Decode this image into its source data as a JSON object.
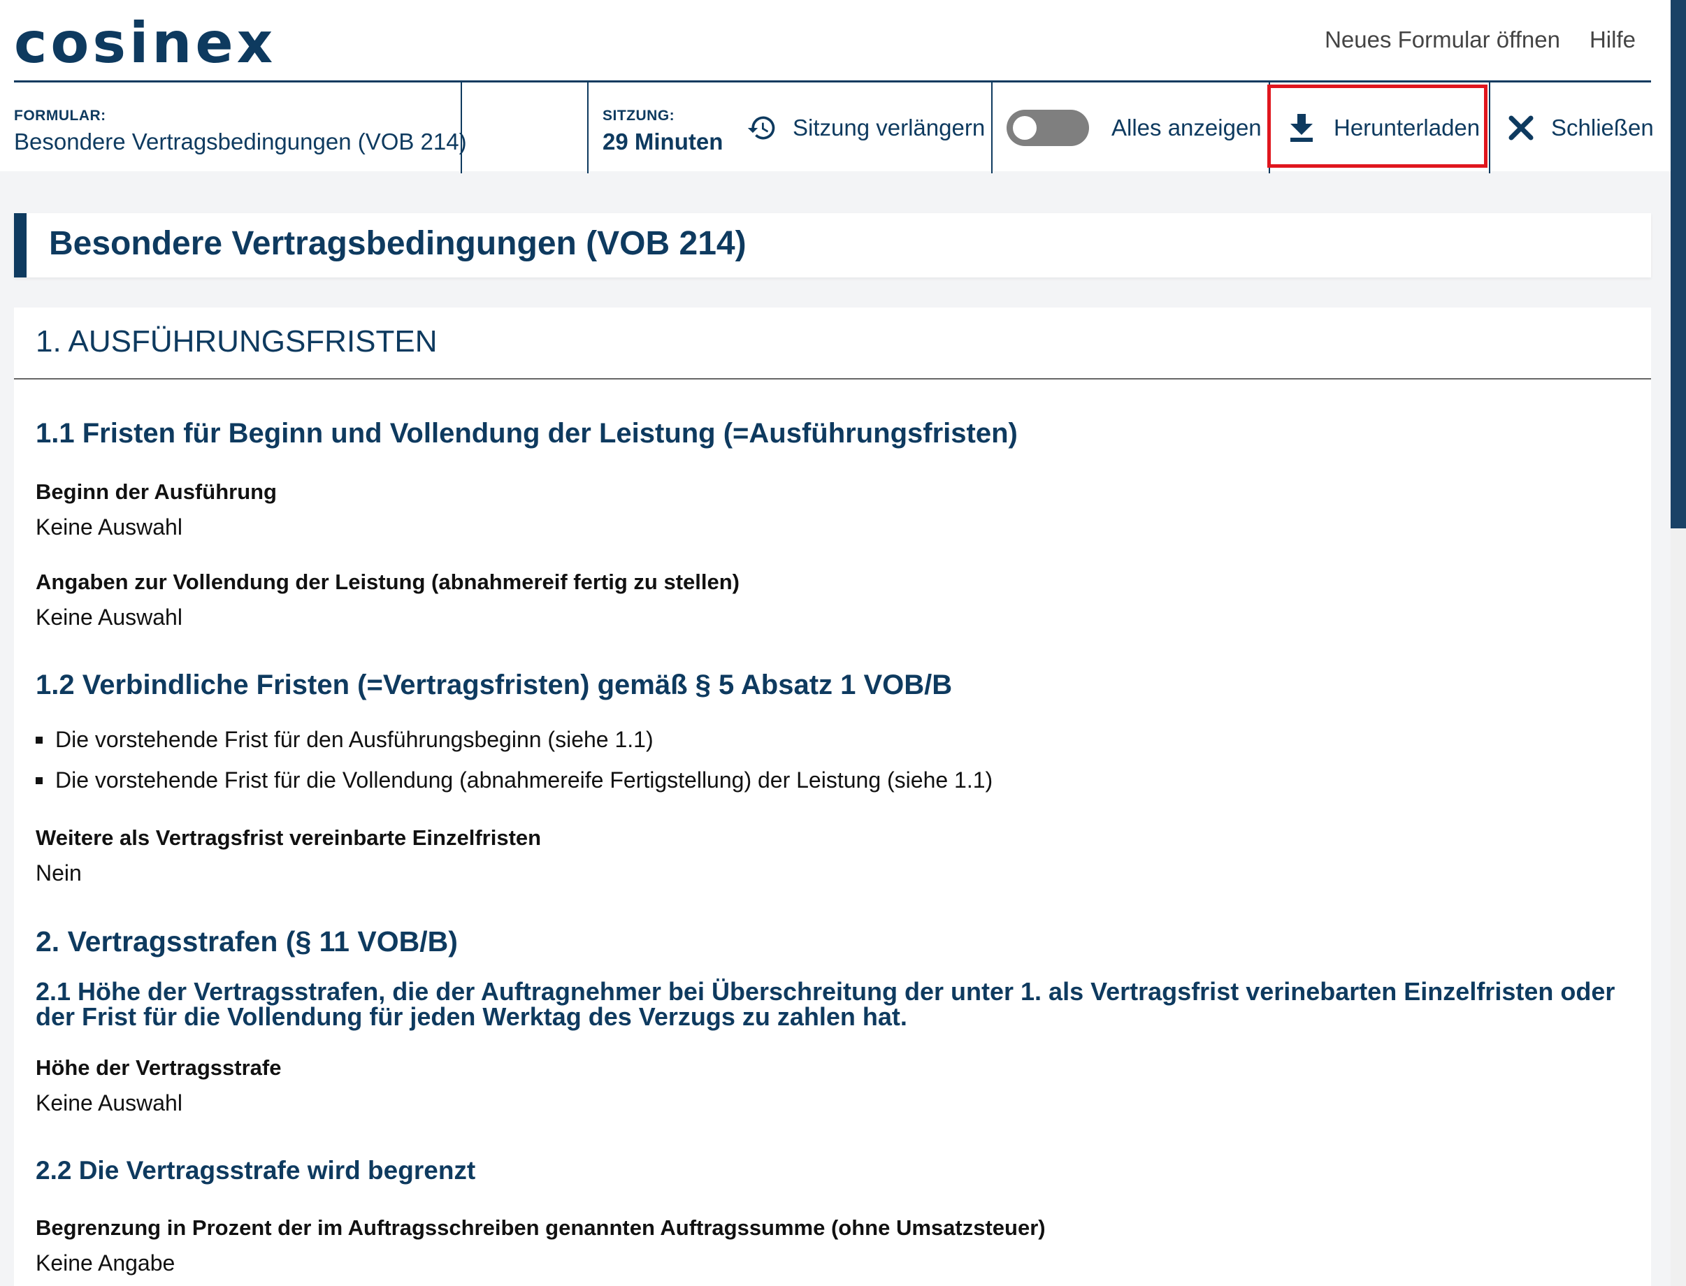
{
  "app": {
    "logo": "cosinex",
    "links": {
      "new_form": "Neues Formular öffnen",
      "help": "Hilfe"
    }
  },
  "toolbar": {
    "form_label": "FORMULAR:",
    "form_value": "Besondere Vertragsbedingungen (VOB 214)",
    "session_label": "SITZUNG:",
    "session_value": "29 Minuten",
    "extend_session": "Sitzung verlängern",
    "show_all": "Alles anzeigen",
    "show_all_enabled": false,
    "download": "Herunterladen",
    "close": "Schließen"
  },
  "page": {
    "title": "Besondere Vertragsbedingungen (VOB 214)",
    "section1": {
      "heading": "1. AUSFÜHRUNGSFRISTEN",
      "sub1": "1.1 Fristen für Beginn und Vollendung der Leistung (=Ausführungsfristen)",
      "field_begin_label": "Beginn der Ausführung",
      "field_begin_value": "Keine Auswahl",
      "field_completion_label": "Angaben zur Vollendung der Leistung (abnahmereif fertig zu stellen)",
      "field_completion_value": "Keine Auswahl",
      "sub2": "1.2 Verbindliche Fristen (=Vertragsfristen) gemäß § 5 Absatz 1 VOB/B",
      "bullets": [
        "Die vorstehende Frist für den Ausführungsbeginn (siehe 1.1)",
        "Die vorstehende Frist für die Vollendung (abnahmereife Fertigstellung) der Leistung (siehe 1.1)"
      ],
      "field_further_label": "Weitere als Vertragsfrist vereinbarte Einzelfristen",
      "field_further_value": "Nein"
    },
    "section2": {
      "heading": "2. Vertragsstrafen (§ 11 VOB/B)",
      "sub1": "2.1 Höhe der Vertragsstrafen, die der Auftragnehmer bei Überschreitung der unter 1. als Vertragsfrist verinebarten Einzelfristen oder der Frist für die Vollendung für jeden Werktag des Verzugs zu zahlen hat.",
      "field_amount_label": "Höhe der Vertragsstrafe",
      "field_amount_value": "Keine Auswahl",
      "sub2": "2.2 Die Vertragsstrafe wird begrenzt",
      "field_limit_label": "Begrenzung in Prozent der im Auftragsschreiben genannten Auftragssumme (ohne Umsatzsteuer)",
      "field_limit_value": "Keine Angabe"
    }
  },
  "colors": {
    "brand": "#0e3a5f",
    "highlight": "#e0161e",
    "background": "#f3f4f6"
  }
}
